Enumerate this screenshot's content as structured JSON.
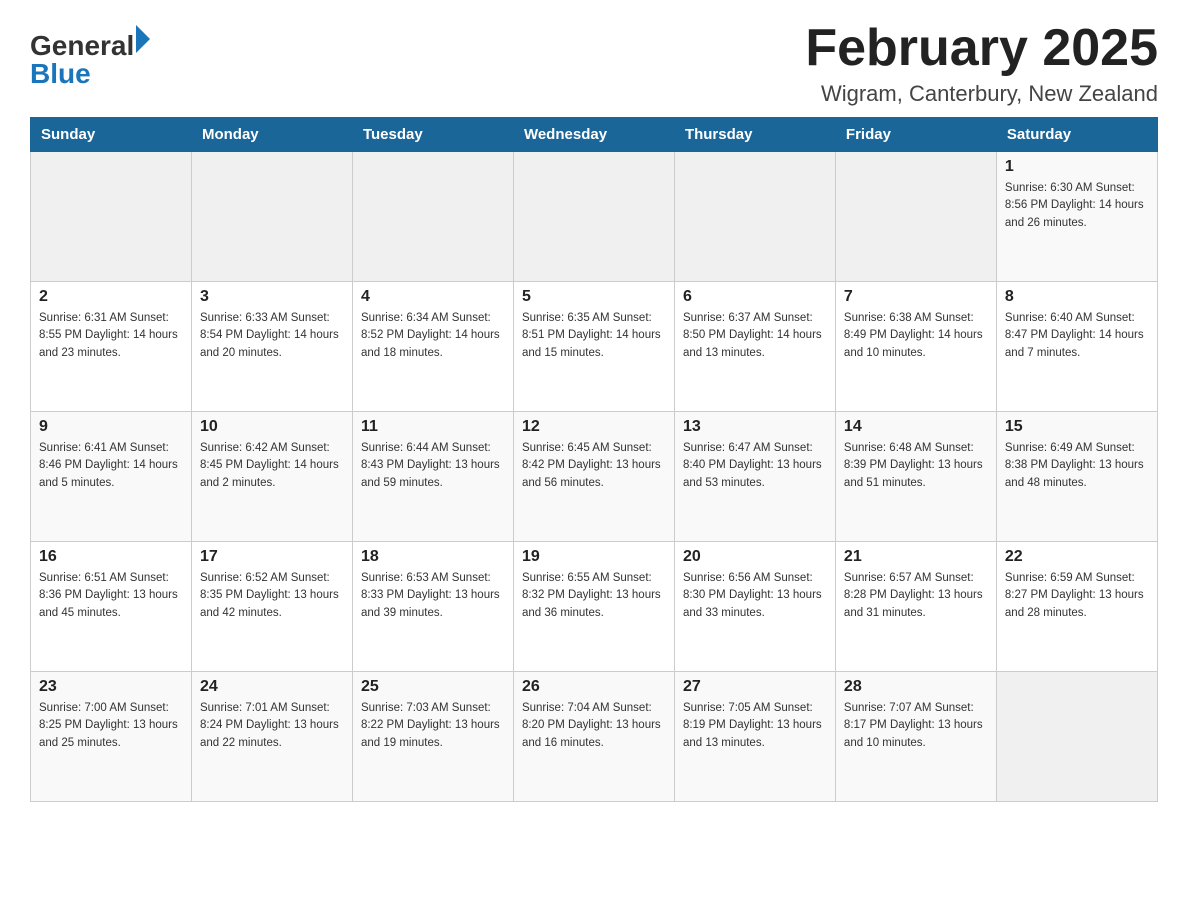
{
  "header": {
    "title": "February 2025",
    "location": "Wigram, Canterbury, New Zealand"
  },
  "logo": {
    "general": "General",
    "blue": "Blue"
  },
  "days_header": [
    "Sunday",
    "Monday",
    "Tuesday",
    "Wednesday",
    "Thursday",
    "Friday",
    "Saturday"
  ],
  "weeks": [
    {
      "days": [
        {
          "date": "",
          "info": ""
        },
        {
          "date": "",
          "info": ""
        },
        {
          "date": "",
          "info": ""
        },
        {
          "date": "",
          "info": ""
        },
        {
          "date": "",
          "info": ""
        },
        {
          "date": "",
          "info": ""
        },
        {
          "date": "1",
          "info": "Sunrise: 6:30 AM\nSunset: 8:56 PM\nDaylight: 14 hours and 26 minutes."
        }
      ]
    },
    {
      "days": [
        {
          "date": "2",
          "info": "Sunrise: 6:31 AM\nSunset: 8:55 PM\nDaylight: 14 hours and 23 minutes."
        },
        {
          "date": "3",
          "info": "Sunrise: 6:33 AM\nSunset: 8:54 PM\nDaylight: 14 hours and 20 minutes."
        },
        {
          "date": "4",
          "info": "Sunrise: 6:34 AM\nSunset: 8:52 PM\nDaylight: 14 hours and 18 minutes."
        },
        {
          "date": "5",
          "info": "Sunrise: 6:35 AM\nSunset: 8:51 PM\nDaylight: 14 hours and 15 minutes."
        },
        {
          "date": "6",
          "info": "Sunrise: 6:37 AM\nSunset: 8:50 PM\nDaylight: 14 hours and 13 minutes."
        },
        {
          "date": "7",
          "info": "Sunrise: 6:38 AM\nSunset: 8:49 PM\nDaylight: 14 hours and 10 minutes."
        },
        {
          "date": "8",
          "info": "Sunrise: 6:40 AM\nSunset: 8:47 PM\nDaylight: 14 hours and 7 minutes."
        }
      ]
    },
    {
      "days": [
        {
          "date": "9",
          "info": "Sunrise: 6:41 AM\nSunset: 8:46 PM\nDaylight: 14 hours and 5 minutes."
        },
        {
          "date": "10",
          "info": "Sunrise: 6:42 AM\nSunset: 8:45 PM\nDaylight: 14 hours and 2 minutes."
        },
        {
          "date": "11",
          "info": "Sunrise: 6:44 AM\nSunset: 8:43 PM\nDaylight: 13 hours and 59 minutes."
        },
        {
          "date": "12",
          "info": "Sunrise: 6:45 AM\nSunset: 8:42 PM\nDaylight: 13 hours and 56 minutes."
        },
        {
          "date": "13",
          "info": "Sunrise: 6:47 AM\nSunset: 8:40 PM\nDaylight: 13 hours and 53 minutes."
        },
        {
          "date": "14",
          "info": "Sunrise: 6:48 AM\nSunset: 8:39 PM\nDaylight: 13 hours and 51 minutes."
        },
        {
          "date": "15",
          "info": "Sunrise: 6:49 AM\nSunset: 8:38 PM\nDaylight: 13 hours and 48 minutes."
        }
      ]
    },
    {
      "days": [
        {
          "date": "16",
          "info": "Sunrise: 6:51 AM\nSunset: 8:36 PM\nDaylight: 13 hours and 45 minutes."
        },
        {
          "date": "17",
          "info": "Sunrise: 6:52 AM\nSunset: 8:35 PM\nDaylight: 13 hours and 42 minutes."
        },
        {
          "date": "18",
          "info": "Sunrise: 6:53 AM\nSunset: 8:33 PM\nDaylight: 13 hours and 39 minutes."
        },
        {
          "date": "19",
          "info": "Sunrise: 6:55 AM\nSunset: 8:32 PM\nDaylight: 13 hours and 36 minutes."
        },
        {
          "date": "20",
          "info": "Sunrise: 6:56 AM\nSunset: 8:30 PM\nDaylight: 13 hours and 33 minutes."
        },
        {
          "date": "21",
          "info": "Sunrise: 6:57 AM\nSunset: 8:28 PM\nDaylight: 13 hours and 31 minutes."
        },
        {
          "date": "22",
          "info": "Sunrise: 6:59 AM\nSunset: 8:27 PM\nDaylight: 13 hours and 28 minutes."
        }
      ]
    },
    {
      "days": [
        {
          "date": "23",
          "info": "Sunrise: 7:00 AM\nSunset: 8:25 PM\nDaylight: 13 hours and 25 minutes."
        },
        {
          "date": "24",
          "info": "Sunrise: 7:01 AM\nSunset: 8:24 PM\nDaylight: 13 hours and 22 minutes."
        },
        {
          "date": "25",
          "info": "Sunrise: 7:03 AM\nSunset: 8:22 PM\nDaylight: 13 hours and 19 minutes."
        },
        {
          "date": "26",
          "info": "Sunrise: 7:04 AM\nSunset: 8:20 PM\nDaylight: 13 hours and 16 minutes."
        },
        {
          "date": "27",
          "info": "Sunrise: 7:05 AM\nSunset: 8:19 PM\nDaylight: 13 hours and 13 minutes."
        },
        {
          "date": "28",
          "info": "Sunrise: 7:07 AM\nSunset: 8:17 PM\nDaylight: 13 hours and 10 minutes."
        },
        {
          "date": "",
          "info": ""
        }
      ]
    }
  ]
}
